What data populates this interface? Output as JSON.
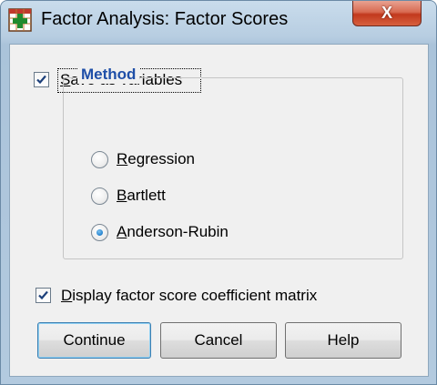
{
  "window": {
    "title": "Factor Analysis: Factor Scores",
    "close_glyph": "X"
  },
  "save_as_variables": {
    "mnemonic": "S",
    "label_rest": "ave as variables",
    "checked": true
  },
  "method": {
    "title": "Method",
    "options": [
      {
        "mnemonic": "R",
        "label_rest": "egression",
        "selected": false
      },
      {
        "mnemonic": "B",
        "label_rest": "artlett",
        "selected": false
      },
      {
        "mnemonic": "A",
        "label_rest": "nderson-Rubin",
        "selected": true
      }
    ]
  },
  "display_matrix": {
    "mnemonic": "D",
    "label_rest": "isplay factor score coefficient matrix",
    "checked": true
  },
  "buttons": {
    "continue": "Continue",
    "cancel": "Cancel",
    "help": "Help"
  },
  "icons": {
    "app": "spss-grid-plus-icon",
    "check": "checkmark-icon"
  },
  "colors": {
    "group_title": "#1f4fa8",
    "close_button": "#c2391d",
    "checkmark": "#1c3f7a"
  }
}
